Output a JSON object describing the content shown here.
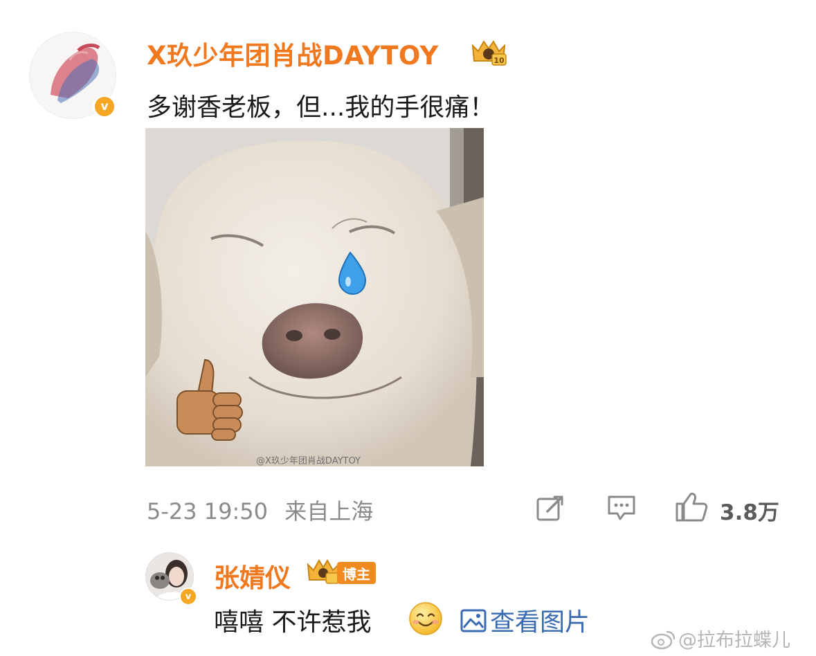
{
  "main_comment": {
    "username": "X玖少年团肖战DAYTOY",
    "text": "多谢香老板，但...我的手很痛！",
    "image_watermark": "@X玖少年团肖战DAYTOY",
    "timestamp": "5-23 19:50",
    "location": "来自上海",
    "likes": "3.8万",
    "crown_level": "10"
  },
  "reply": {
    "username": "张婧仪",
    "role_badge": "博主",
    "text": "嘻嘻 不许惹我",
    "link_label": "查看图片"
  },
  "watermark": "@拉布拉蝶儿",
  "icons": [
    "verified-badge-icon",
    "crown-badge-icon",
    "repost-icon",
    "comment-icon",
    "like-icon",
    "image-icon",
    "smile-emoji-icon",
    "weibo-logo-icon"
  ],
  "colors": {
    "username": "#f0781e",
    "link": "#3a6ab0",
    "meta": "#8a8a8a",
    "verified": "#f5a623"
  }
}
